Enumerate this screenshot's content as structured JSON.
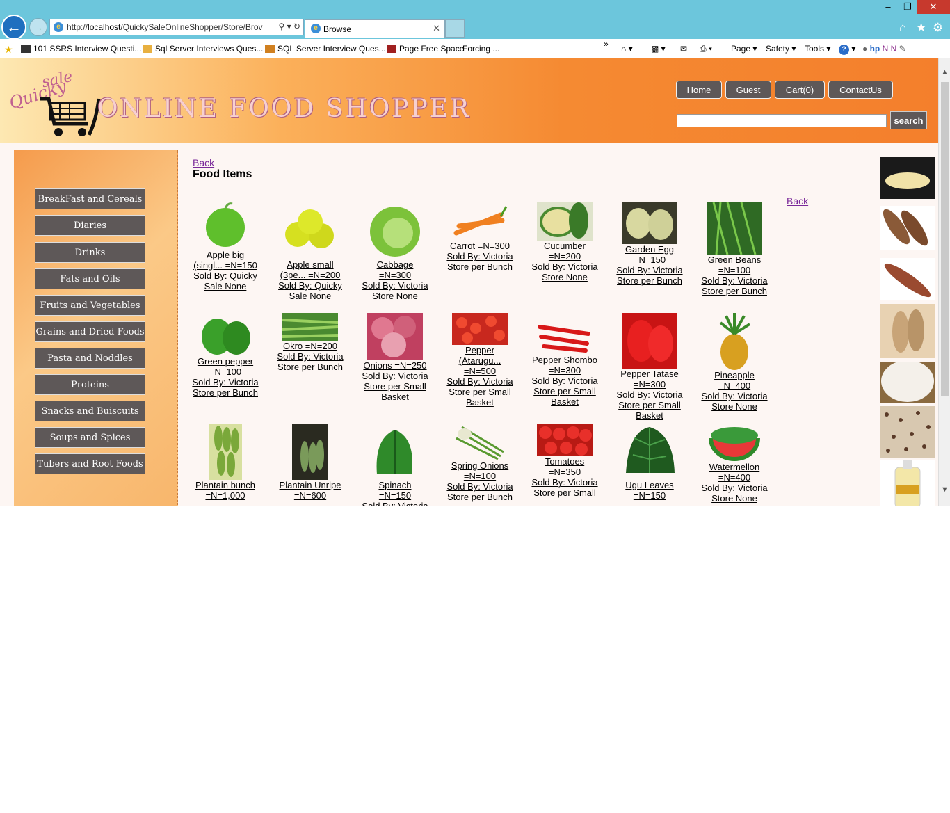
{
  "browser": {
    "url_prefix": "http://",
    "url_host": "localhost",
    "url_path": "/QuickySaleOnlineShopper/Store/Brov",
    "tab_title": "Browse",
    "favorites": [
      "101 SSRS Interview Questi...",
      "Sql Server Interviews Ques...",
      "SQL Server Interview Ques...",
      "Page Free Space",
      "Forcing ..."
    ],
    "commands": [
      "Page",
      "Safety",
      "Tools"
    ]
  },
  "header": {
    "logo_sale": "sale",
    "logo_quicky": "Quicky",
    "logo_title": "ONLINE FOOD SHOPPER",
    "nav": [
      "Home",
      "Guest",
      "Cart(0)",
      "ContactUs"
    ],
    "search_label": "search",
    "search_value": ""
  },
  "categories": [
    "BreakFast and Cereals",
    "Diaries",
    "Drinks",
    "Fats and Oils",
    "Fruits and Vegetables",
    "Grains and Dried Foods",
    "Pasta and Noddles",
    "Proteins",
    "Snacks and Buiscuits",
    "Soups and Spices",
    "Tubers and Root Foods"
  ],
  "content": {
    "back": "Back",
    "title": "Food Items",
    "back2": "Back"
  },
  "items": [
    [
      "Apple big",
      "(singl... =N=150",
      "Sold By: Quicky",
      "Sale None"
    ],
    [
      "Apple small",
      "(3pe... =N=200",
      "Sold By: Quicky",
      "Sale None"
    ],
    [
      "Cabbage",
      "=N=300",
      "Sold By: Victoria",
      "Store None"
    ],
    [
      "Carrot =N=300",
      "Sold By: Victoria",
      "Store per Bunch"
    ],
    [
      "Cucumber",
      "=N=200",
      "Sold By: Victoria",
      "Store None"
    ],
    [
      "Garden Egg",
      "=N=150",
      "Sold By: Victoria",
      "Store per Bunch"
    ],
    [
      "Green Beans",
      "=N=100",
      "Sold By: Victoria",
      "Store per Bunch"
    ],
    [
      "Green pepper",
      "=N=100",
      "Sold By: Victoria",
      "Store per Bunch"
    ],
    [
      "Okro =N=200",
      "Sold By: Victoria",
      "Store per Bunch"
    ],
    [
      "Onions =N=250",
      "Sold By: Victoria",
      "Store per Small",
      "Basket"
    ],
    [
      "Pepper",
      "(Atarugu...",
      "=N=500",
      "Sold By: Victoria",
      "Store per Small",
      "Basket"
    ],
    [
      "Pepper Shombo",
      "=N=300",
      "Sold By: Victoria",
      "Store per Small",
      "Basket"
    ],
    [
      "Pepper Tatase",
      "=N=300",
      "Sold By: Victoria",
      "Store per Small",
      "Basket"
    ],
    [
      "Pineapple",
      "=N=400",
      "Sold By: Victoria",
      "Store None"
    ],
    [
      "Plantain bunch",
      "=N=1,000"
    ],
    [
      "Plantain Unripe",
      "=N=600"
    ],
    [
      "Spinach",
      "=N=150",
      "Sold By: Victoria"
    ],
    [
      "Spring Onions",
      "=N=100",
      "Sold By: Victoria",
      "Store per Bunch"
    ],
    [
      "Tomatoes",
      "=N=350",
      "Sold By: Victoria",
      "Store per Small"
    ],
    [
      "Ugu Leaves",
      "=N=150"
    ],
    [
      "Watermellon",
      "=N=400",
      "Sold By: Victoria",
      "Store None"
    ]
  ],
  "colors": {
    "button_bg": "#5e5858",
    "header_orange": "#f47f2c",
    "link_visited": "#7a2a9a"
  }
}
